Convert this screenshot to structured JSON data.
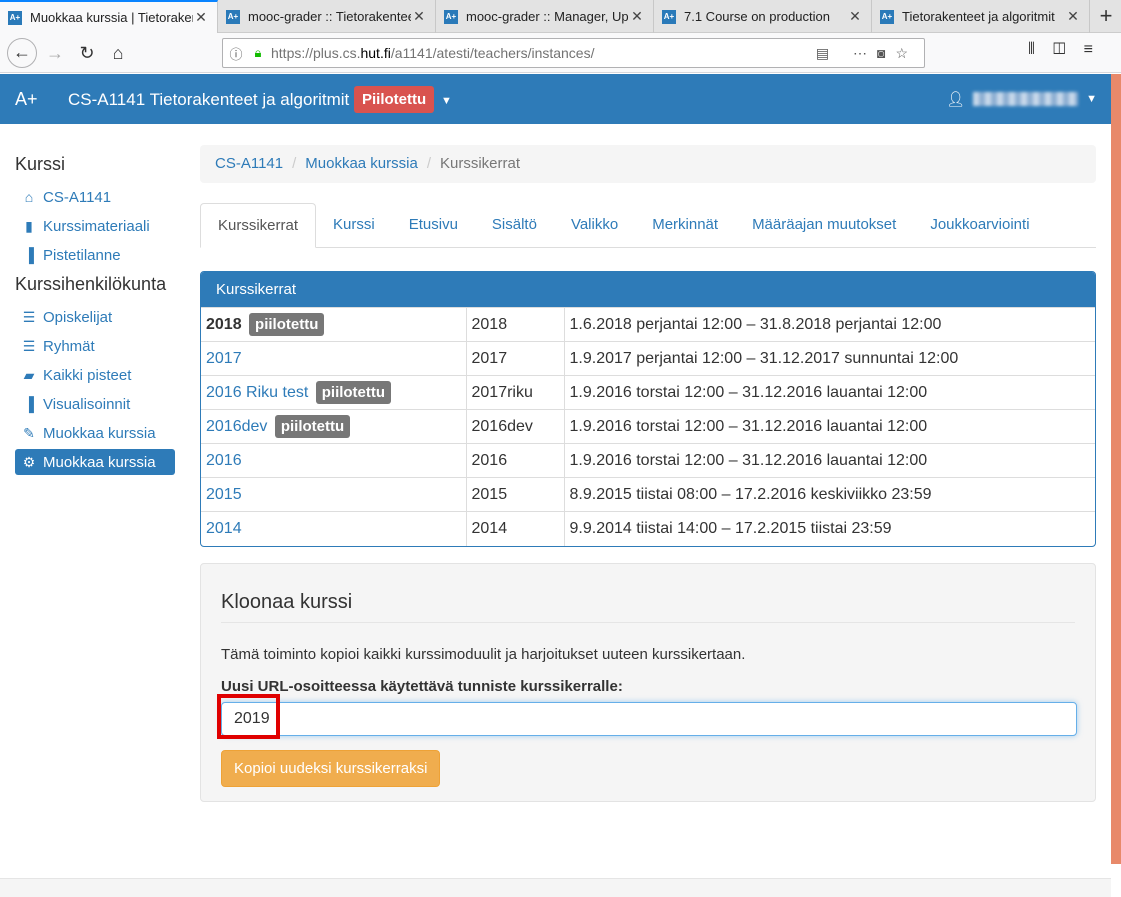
{
  "browser": {
    "tabs": [
      {
        "label": "Muokkaa kurssia | Tietorakenteet",
        "active": true
      },
      {
        "label": "mooc-grader :: Tietorakenteet"
      },
      {
        "label": "mooc-grader :: Manager, Upload"
      },
      {
        "label": "7.1 Course on production"
      },
      {
        "label": "Tietorakenteet ja algoritmit"
      }
    ],
    "favicon": "A+",
    "close_glyph": "✕",
    "newtab_glyph": "+",
    "url_prefix": "https://plus.cs.",
    "url_host": "hut.fi",
    "url_path": "/a1141/atesti/teachers/instances/"
  },
  "app": {
    "brand": "A+",
    "course_title": "CS-A1141 Tietorakenteet ja algoritmit Y",
    "pilot_badge": "Piilotettu",
    "accent": "#2e7bb8"
  },
  "sidebar": {
    "heading1": "Kurssi",
    "items1": [
      {
        "label": "CS-A1141",
        "icon": "home-icon"
      },
      {
        "label": "Kurssimateriaali",
        "icon": "book-icon"
      },
      {
        "label": "Pistetilanne",
        "icon": "bar-chart-icon"
      }
    ],
    "heading2": "Kurssihenkilökunta",
    "items2": [
      {
        "label": "Opiskelijat",
        "icon": "list-icon"
      },
      {
        "label": "Ryhmät",
        "icon": "list-icon"
      },
      {
        "label": "Kaikki pisteet",
        "icon": "folder-open-icon"
      },
      {
        "label": "Visualisoinnit",
        "icon": "bar-chart-icon"
      },
      {
        "label": "Muokkaa kurssia",
        "icon": "pencil-icon"
      },
      {
        "label": "Muokkaa kurssia",
        "icon": "gear-icon",
        "active": true
      }
    ]
  },
  "breadcrumb": [
    "CS-A1141",
    "Muokkaa kurssia",
    "Kurssikerrat"
  ],
  "tabs": [
    "Kurssikerrat",
    "Kurssi",
    "Etusivu",
    "Sisältö",
    "Valikko",
    "Merkinnät",
    "Määräajan muutokset",
    "Joukkoarviointi"
  ],
  "instances": {
    "heading": "Kurssikerrat",
    "hidden_label": "piilotettu",
    "rows": [
      {
        "name": "2018",
        "hidden": true,
        "bold": true,
        "url": "2018",
        "dates": "1.6.2018 perjantai 12:00 – 31.8.2018 perjantai 12:00"
      },
      {
        "name": "2017",
        "hidden": false,
        "url": "2017",
        "dates": "1.9.2017 perjantai 12:00 – 31.12.2017 sunnuntai 12:00"
      },
      {
        "name": "2016 Riku test",
        "hidden": true,
        "url": "2017riku",
        "dates": "1.9.2016 torstai 12:00 – 31.12.2016 lauantai 12:00"
      },
      {
        "name": "2016dev",
        "hidden": true,
        "url": "2016dev",
        "dates": "1.9.2016 torstai 12:00 – 31.12.2016 lauantai 12:00"
      },
      {
        "name": "2016",
        "hidden": false,
        "url": "2016",
        "dates": "1.9.2016 torstai 12:00 – 31.12.2016 lauantai 12:00"
      },
      {
        "name": "2015",
        "hidden": false,
        "url": "2015",
        "dates": "8.9.2015 tiistai 08:00 – 17.2.2016 keskiviikko 23:59"
      },
      {
        "name": "2014",
        "hidden": false,
        "url": "2014",
        "dates": "9.9.2014 tiistai 14:00 – 17.2.2015 tiistai 23:59"
      }
    ]
  },
  "clone": {
    "title": "Kloonaa kurssi",
    "description": "Tämä toiminto kopioi kaikki kurssimoduulit ja harjoitukset uuteen kurssikertaan.",
    "field_label": "Uusi URL-osoitteessa käytettävä tunniste kurssikerralle:",
    "field_value": "2019",
    "button": "Kopioi uudeksi kurssikerraksi"
  }
}
